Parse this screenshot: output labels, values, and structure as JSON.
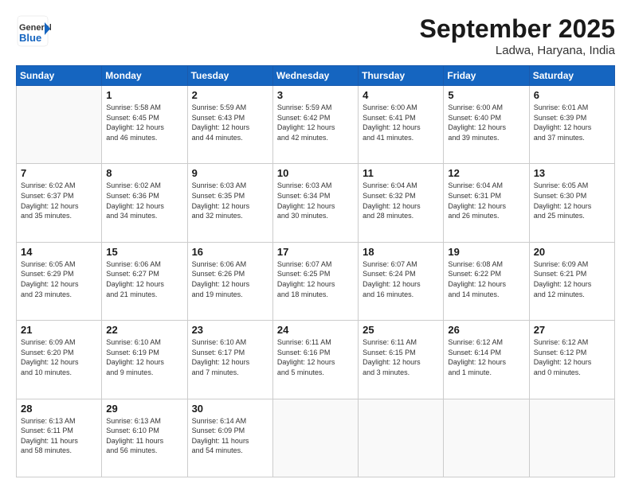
{
  "logo": {
    "line1": "General",
    "line2": "Blue"
  },
  "title": "September 2025",
  "location": "Ladwa, Haryana, India",
  "weekdays": [
    "Sunday",
    "Monday",
    "Tuesday",
    "Wednesday",
    "Thursday",
    "Friday",
    "Saturday"
  ],
  "weeks": [
    [
      {
        "day": "",
        "info": ""
      },
      {
        "day": "1",
        "info": "Sunrise: 5:58 AM\nSunset: 6:45 PM\nDaylight: 12 hours\nand 46 minutes."
      },
      {
        "day": "2",
        "info": "Sunrise: 5:59 AM\nSunset: 6:43 PM\nDaylight: 12 hours\nand 44 minutes."
      },
      {
        "day": "3",
        "info": "Sunrise: 5:59 AM\nSunset: 6:42 PM\nDaylight: 12 hours\nand 42 minutes."
      },
      {
        "day": "4",
        "info": "Sunrise: 6:00 AM\nSunset: 6:41 PM\nDaylight: 12 hours\nand 41 minutes."
      },
      {
        "day": "5",
        "info": "Sunrise: 6:00 AM\nSunset: 6:40 PM\nDaylight: 12 hours\nand 39 minutes."
      },
      {
        "day": "6",
        "info": "Sunrise: 6:01 AM\nSunset: 6:39 PM\nDaylight: 12 hours\nand 37 minutes."
      }
    ],
    [
      {
        "day": "7",
        "info": "Sunrise: 6:02 AM\nSunset: 6:37 PM\nDaylight: 12 hours\nand 35 minutes."
      },
      {
        "day": "8",
        "info": "Sunrise: 6:02 AM\nSunset: 6:36 PM\nDaylight: 12 hours\nand 34 minutes."
      },
      {
        "day": "9",
        "info": "Sunrise: 6:03 AM\nSunset: 6:35 PM\nDaylight: 12 hours\nand 32 minutes."
      },
      {
        "day": "10",
        "info": "Sunrise: 6:03 AM\nSunset: 6:34 PM\nDaylight: 12 hours\nand 30 minutes."
      },
      {
        "day": "11",
        "info": "Sunrise: 6:04 AM\nSunset: 6:32 PM\nDaylight: 12 hours\nand 28 minutes."
      },
      {
        "day": "12",
        "info": "Sunrise: 6:04 AM\nSunset: 6:31 PM\nDaylight: 12 hours\nand 26 minutes."
      },
      {
        "day": "13",
        "info": "Sunrise: 6:05 AM\nSunset: 6:30 PM\nDaylight: 12 hours\nand 25 minutes."
      }
    ],
    [
      {
        "day": "14",
        "info": "Sunrise: 6:05 AM\nSunset: 6:29 PM\nDaylight: 12 hours\nand 23 minutes."
      },
      {
        "day": "15",
        "info": "Sunrise: 6:06 AM\nSunset: 6:27 PM\nDaylight: 12 hours\nand 21 minutes."
      },
      {
        "day": "16",
        "info": "Sunrise: 6:06 AM\nSunset: 6:26 PM\nDaylight: 12 hours\nand 19 minutes."
      },
      {
        "day": "17",
        "info": "Sunrise: 6:07 AM\nSunset: 6:25 PM\nDaylight: 12 hours\nand 18 minutes."
      },
      {
        "day": "18",
        "info": "Sunrise: 6:07 AM\nSunset: 6:24 PM\nDaylight: 12 hours\nand 16 minutes."
      },
      {
        "day": "19",
        "info": "Sunrise: 6:08 AM\nSunset: 6:22 PM\nDaylight: 12 hours\nand 14 minutes."
      },
      {
        "day": "20",
        "info": "Sunrise: 6:09 AM\nSunset: 6:21 PM\nDaylight: 12 hours\nand 12 minutes."
      }
    ],
    [
      {
        "day": "21",
        "info": "Sunrise: 6:09 AM\nSunset: 6:20 PM\nDaylight: 12 hours\nand 10 minutes."
      },
      {
        "day": "22",
        "info": "Sunrise: 6:10 AM\nSunset: 6:19 PM\nDaylight: 12 hours\nand 9 minutes."
      },
      {
        "day": "23",
        "info": "Sunrise: 6:10 AM\nSunset: 6:17 PM\nDaylight: 12 hours\nand 7 minutes."
      },
      {
        "day": "24",
        "info": "Sunrise: 6:11 AM\nSunset: 6:16 PM\nDaylight: 12 hours\nand 5 minutes."
      },
      {
        "day": "25",
        "info": "Sunrise: 6:11 AM\nSunset: 6:15 PM\nDaylight: 12 hours\nand 3 minutes."
      },
      {
        "day": "26",
        "info": "Sunrise: 6:12 AM\nSunset: 6:14 PM\nDaylight: 12 hours\nand 1 minute."
      },
      {
        "day": "27",
        "info": "Sunrise: 6:12 AM\nSunset: 6:12 PM\nDaylight: 12 hours\nand 0 minutes."
      }
    ],
    [
      {
        "day": "28",
        "info": "Sunrise: 6:13 AM\nSunset: 6:11 PM\nDaylight: 11 hours\nand 58 minutes."
      },
      {
        "day": "29",
        "info": "Sunrise: 6:13 AM\nSunset: 6:10 PM\nDaylight: 11 hours\nand 56 minutes."
      },
      {
        "day": "30",
        "info": "Sunrise: 6:14 AM\nSunset: 6:09 PM\nDaylight: 11 hours\nand 54 minutes."
      },
      {
        "day": "",
        "info": ""
      },
      {
        "day": "",
        "info": ""
      },
      {
        "day": "",
        "info": ""
      },
      {
        "day": "",
        "info": ""
      }
    ]
  ]
}
